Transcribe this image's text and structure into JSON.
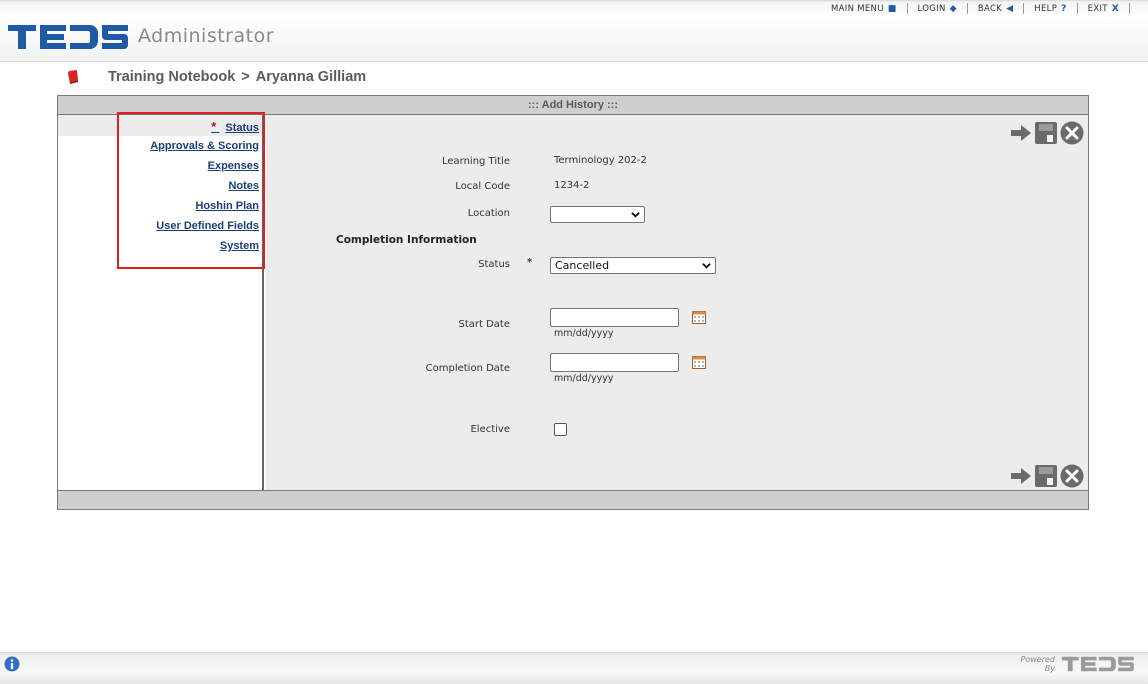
{
  "top_nav": {
    "main_menu": "MAIN MENU",
    "login": "LOGIN",
    "back": "BACK",
    "help": "HELP",
    "exit": "EXIT"
  },
  "brand": {
    "logo_text": "TEDS",
    "subtitle": "Administrator"
  },
  "breadcrumb": {
    "parent": "Training Notebook",
    "separator": ">",
    "current": "Aryanna Gilliam"
  },
  "panel": {
    "title": "::: Add History :::"
  },
  "sidebar": {
    "items": [
      {
        "label": "Status",
        "required": true,
        "selected": true
      },
      {
        "label": "Approvals & Scoring"
      },
      {
        "label": "Expenses"
      },
      {
        "label": "Notes"
      },
      {
        "label": "Hoshin Plan"
      },
      {
        "label": "User Defined Fields"
      },
      {
        "label": "System"
      }
    ],
    "required_mark": "*"
  },
  "form": {
    "learning_title": {
      "label": "Learning Title",
      "value": "Terminology 202-2"
    },
    "local_code": {
      "label": "Local Code",
      "value": "1234-2"
    },
    "location": {
      "label": "Location",
      "value": ""
    },
    "section_title": "Completion Information",
    "status": {
      "label": "Status",
      "value": "Cancelled",
      "required_mark": "*"
    },
    "start_date": {
      "label": "Start Date",
      "value": "",
      "hint": "mm/dd/yyyy"
    },
    "completion_date": {
      "label": "Completion Date",
      "value": "",
      "hint": "mm/dd/yyyy"
    },
    "elective": {
      "label": "Elective",
      "checked": false
    }
  },
  "footer": {
    "powered_line1": "Powered",
    "powered_line2": "By"
  },
  "colors": {
    "accent_blue": "#1f5aa6",
    "link_blue": "#1a3f78",
    "required_red": "#b31b1b",
    "highlight_red": "#e02020"
  }
}
